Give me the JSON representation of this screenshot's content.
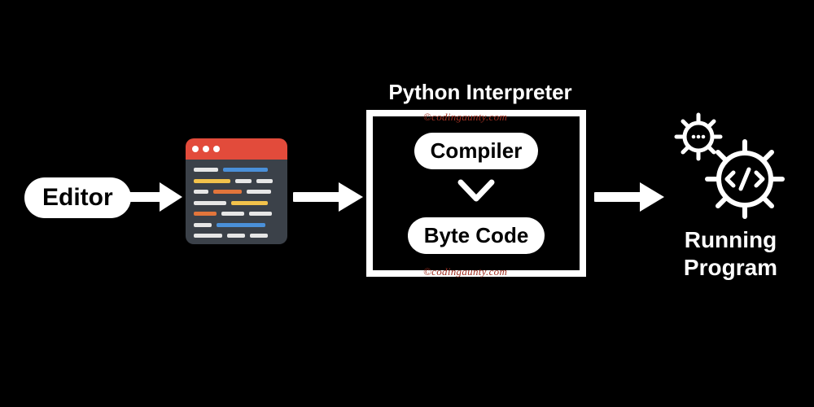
{
  "editor_label": "Editor",
  "interpreter": {
    "title": "Python Interpreter",
    "compiler_label": "Compiler",
    "bytecode_label": "Byte Code"
  },
  "running_label": "Running Program",
  "watermark": "©codingaunty.com",
  "colors": {
    "bg": "#000000",
    "fg": "#ffffff",
    "window_header": "#e24b3b",
    "window_body": "#3b4149",
    "line_white": "#e6e6e6",
    "line_blue": "#4a90d9",
    "line_yellow": "#f2c24b",
    "line_orange": "#e2753b",
    "watermark": "#a03022"
  }
}
